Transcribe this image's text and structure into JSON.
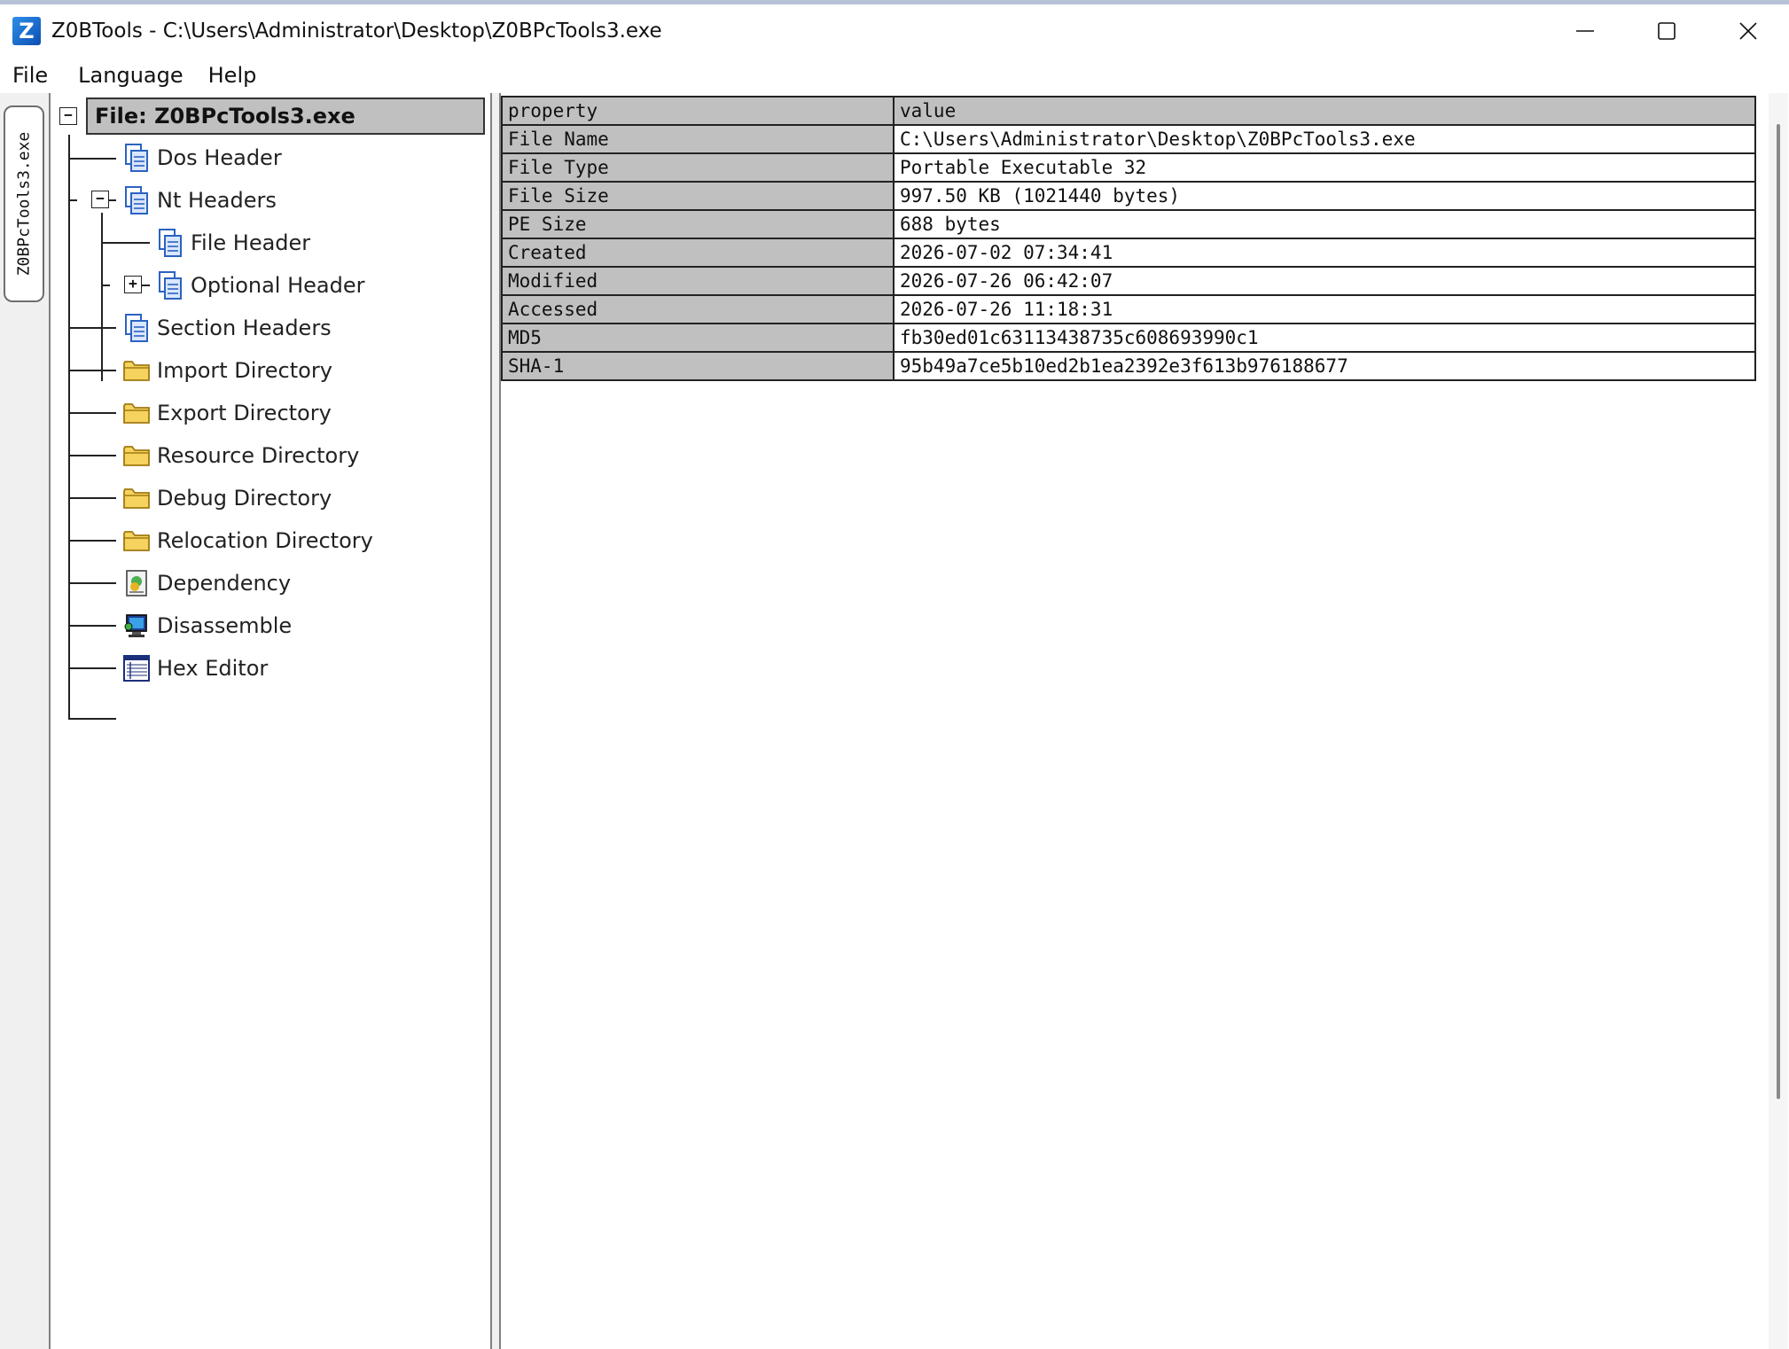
{
  "window": {
    "title": "Z0BTools - C:\\Users\\Administrator\\Desktop\\Z0BPcTools3.exe",
    "app_icon_letter": "Z",
    "controls": [
      "minimize-icon",
      "maximize-icon",
      "close-icon"
    ]
  },
  "menu": {
    "items": [
      "File",
      "Language",
      "Help"
    ]
  },
  "side_tab": {
    "label": "Z0BPcTools3.exe"
  },
  "tree": {
    "root": "File: Z0BPcTools3.exe",
    "items": [
      {
        "label": "Dos Header",
        "icon": "document-icon"
      },
      {
        "label": "Nt Headers",
        "icon": "document-icon"
      },
      {
        "label": "File Header",
        "icon": "document-icon"
      },
      {
        "label": "Optional Header",
        "icon": "document-icon"
      },
      {
        "label": "Section Headers",
        "icon": "document-icon"
      },
      {
        "label": "Import Directory",
        "icon": "folder-icon"
      },
      {
        "label": "Export Directory",
        "icon": "folder-icon"
      },
      {
        "label": "Resource Directory",
        "icon": "folder-icon"
      },
      {
        "label": "Debug Directory",
        "icon": "folder-icon"
      },
      {
        "label": "Relocation Directory",
        "icon": "folder-icon"
      },
      {
        "label": "Dependency",
        "icon": "dependency-icon"
      },
      {
        "label": "Disassemble",
        "icon": "disassemble-icon"
      },
      {
        "label": "Hex Editor",
        "icon": "hex-editor-icon"
      }
    ]
  },
  "table": {
    "headers": {
      "property": "property",
      "value": "value"
    },
    "rows": [
      {
        "property": "File Name",
        "value": "C:\\Users\\Administrator\\Desktop\\Z0BPcTools3.exe"
      },
      {
        "property": "File Type",
        "value": "Portable Executable 32"
      },
      {
        "property": "File Size",
        "value": "997.50 KB (1021440 bytes)"
      },
      {
        "property": "PE Size",
        "value": "688 bytes"
      },
      {
        "property": "Created",
        "value": "2026-07-02 07:34:41"
      },
      {
        "property": "Modified",
        "value": "2026-07-26 06:42:07"
      },
      {
        "property": "Accessed",
        "value": "2026-07-26 11:18:31"
      },
      {
        "property": "MD5",
        "value": "fb30ed01c63113438735c608693990c1"
      },
      {
        "property": "SHA-1",
        "value": "95b49a7ce5b10ed2b1ea2392e3f613b976188677"
      }
    ]
  }
}
